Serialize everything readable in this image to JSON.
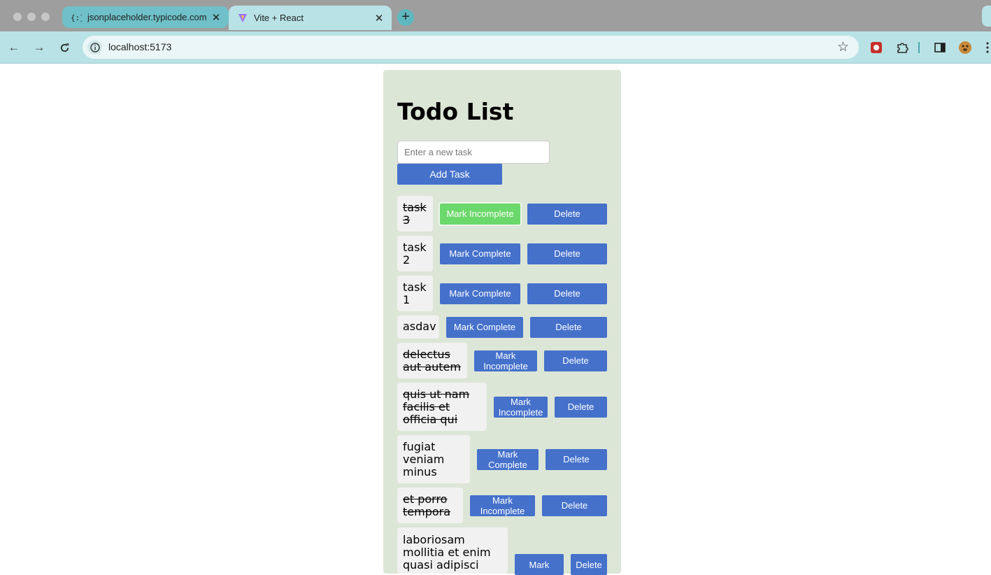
{
  "browser": {
    "tabs": [
      {
        "title": "jsonplaceholder.typicode.com"
      },
      {
        "title": "Vite + React"
      }
    ],
    "url": "localhost:5173",
    "colors": {
      "tabstrip": "#9e9e9e",
      "toolbar": "#b9e2e6"
    }
  },
  "app": {
    "title": "Todo List",
    "input_placeholder": "Enter a new task",
    "input_value": "",
    "add_label": "Add Task",
    "colors": {
      "panel": "#dce6d7",
      "button": "#4571cb",
      "completed_button": "#6ad86a"
    },
    "tasks": [
      {
        "text": "task 3",
        "completed": true,
        "toggle_label": "Mark Incomplete",
        "delete_label": "Delete"
      },
      {
        "text": "task 2",
        "completed": false,
        "toggle_label": "Mark Complete",
        "delete_label": "Delete"
      },
      {
        "text": "task 1",
        "completed": false,
        "toggle_label": "Mark Complete",
        "delete_label": "Delete"
      },
      {
        "text": "asdav",
        "completed": false,
        "toggle_label": "Mark Complete",
        "delete_label": "Delete"
      },
      {
        "text": "delectus aut autem",
        "completed": true,
        "toggle_label": "Mark Incomplete",
        "delete_label": "Delete"
      },
      {
        "text": "quis ut nam facilis et officia qui",
        "completed": true,
        "toggle_label": "Mark Incomplete",
        "delete_label": "Delete"
      },
      {
        "text": "fugiat veniam minus",
        "completed": false,
        "toggle_label": "Mark Complete",
        "delete_label": "Delete"
      },
      {
        "text": "et porro tempora",
        "completed": true,
        "toggle_label": "Mark Incomplete",
        "delete_label": "Delete"
      },
      {
        "text": "laboriosam mollitia et enim quasi adipisci",
        "completed": false,
        "toggle_label": "Mark",
        "delete_label": "Delete"
      }
    ]
  }
}
